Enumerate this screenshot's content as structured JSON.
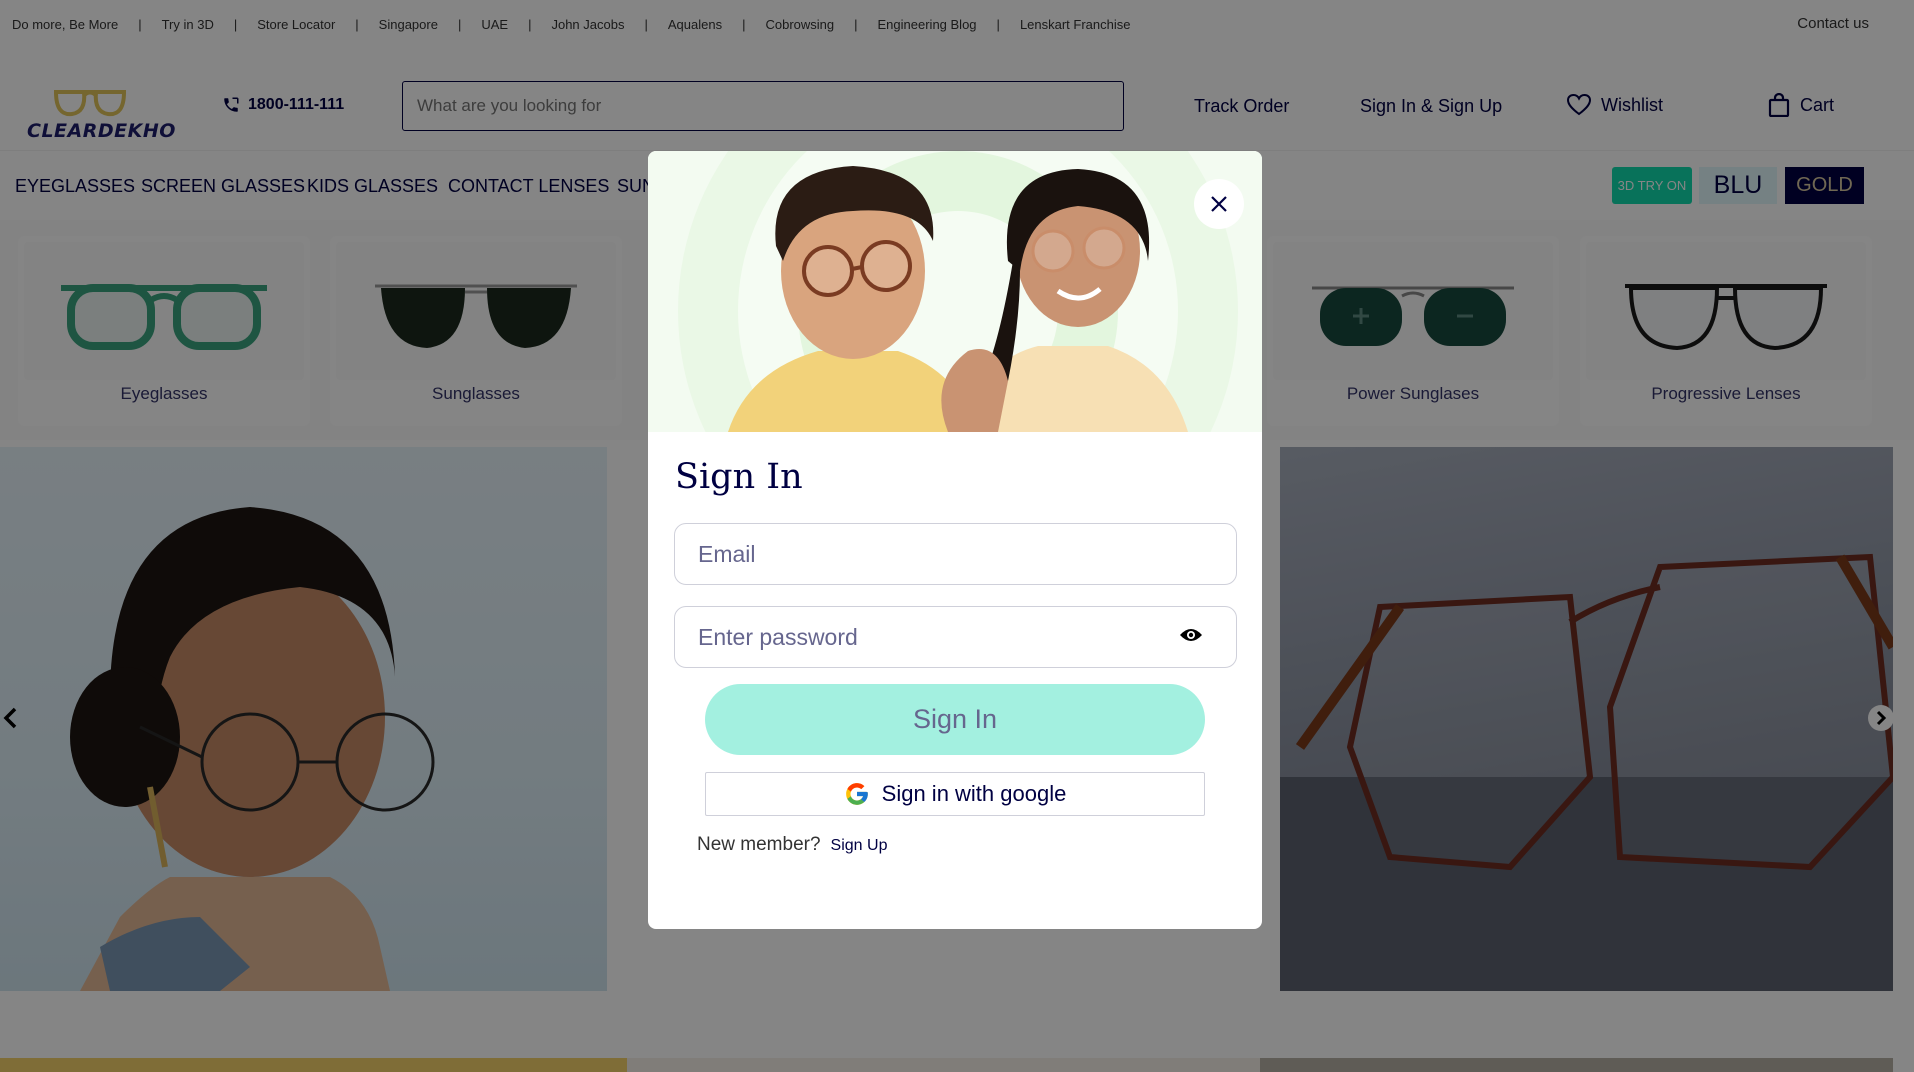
{
  "top_links": [
    "Do more, Be More",
    "Try in 3D",
    "Store Locator",
    "Singapore",
    "UAE",
    "John Jacobs",
    "Aqualens",
    "Cobrowsing",
    "Engineering Blog",
    "Lenskart Franchise"
  ],
  "contact_us": "Contact us",
  "header": {
    "logo_text": "CLEARDEKHO",
    "phone": "1800-111-111",
    "search_placeholder": "What are you looking for",
    "track_order": "Track Order",
    "sign_in_signup": "Sign In & Sign Up",
    "wishlist": "Wishlist",
    "cart": "Cart"
  },
  "nav": {
    "items": [
      "EYEGLASSES",
      "SCREEN GLASSES",
      "KIDS GLASSES",
      "CONTACT LENSES",
      "SUN"
    ],
    "badges": {
      "try_on": "3D TRY ON",
      "blu": "BLU",
      "gold": "GOLD"
    }
  },
  "categories": [
    "Eyeglasses",
    "Sunglasses",
    "Power Sunglases",
    "Progressive Lenses"
  ],
  "modal": {
    "title": "Sign In",
    "email_placeholder": "Email",
    "password_placeholder": "Enter password",
    "sign_in_button": "Sign In",
    "google_button": "Sign in with google",
    "new_member": "New member?",
    "sign_up": "Sign Up"
  },
  "icons": {
    "phone": "phone-icon",
    "wishlist": "heart-icon",
    "cart": "bag-icon",
    "close": "close-icon",
    "eye": "eye-icon",
    "google": "google-icon",
    "prev": "chevron-left-icon",
    "next": "chevron-right-icon"
  },
  "colors": {
    "brand": "#000042",
    "accent_teal": "#11daac",
    "signin_button": "#a3f0e0",
    "gold_badge": "#000042"
  }
}
